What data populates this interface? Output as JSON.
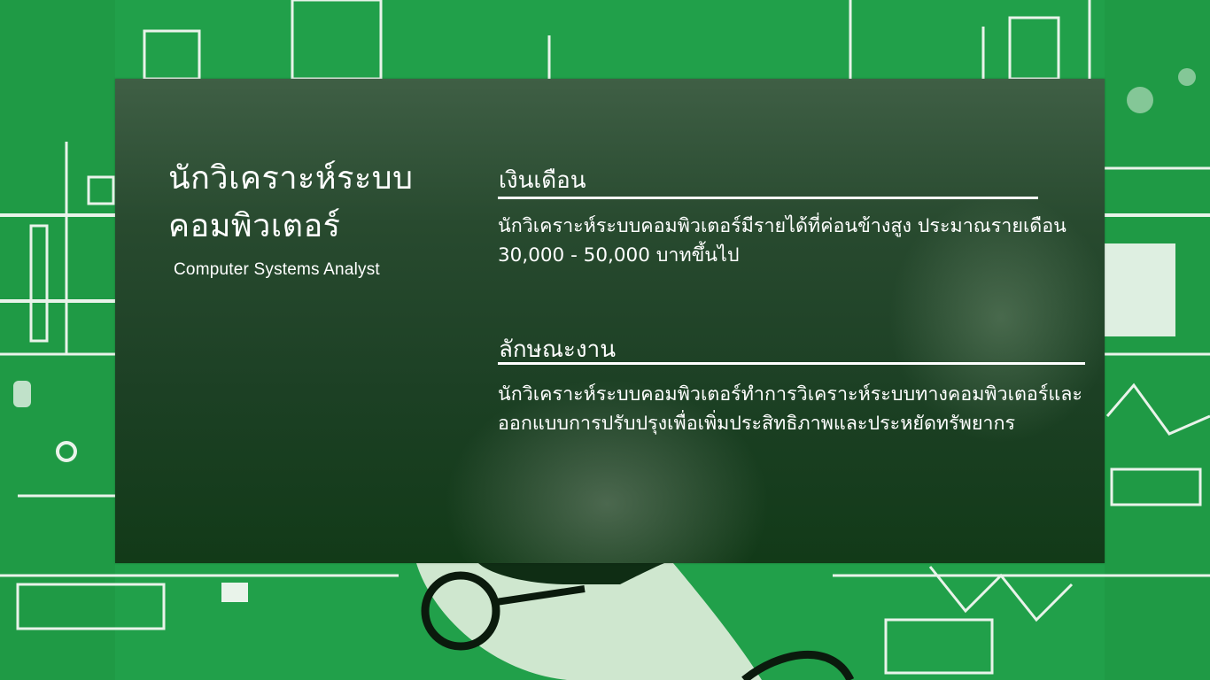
{
  "title_th": "นักวิเคราะห์ระบบคอมพิวเตอร์",
  "title_en": "Computer Systems Analyst",
  "salary": {
    "heading": "เงินเดือน",
    "text": "นักวิเคราะห์ระบบคอมพิวเตอร์มีรายได้ที่ค่อนข้างสูง ประมาณรายเดือน 30,000 - 50,000 บาทขึ้นไป"
  },
  "job": {
    "heading": "ลักษณะงาน",
    "text": "นักวิเคราะห์ระบบคอมพิวเตอร์ทำการวิเคราะห์ระบบทางคอมพิวเตอร์และออกแบบการปรับปรุงเพื่อเพิ่มประสิทธิภาพและประหยัดทรัพยากร"
  },
  "colors": {
    "background": "#21a04a",
    "card": "#1c4024",
    "text": "#ffffff"
  },
  "background_image": "green-illustration-of-person-with-glasses-at-computer"
}
